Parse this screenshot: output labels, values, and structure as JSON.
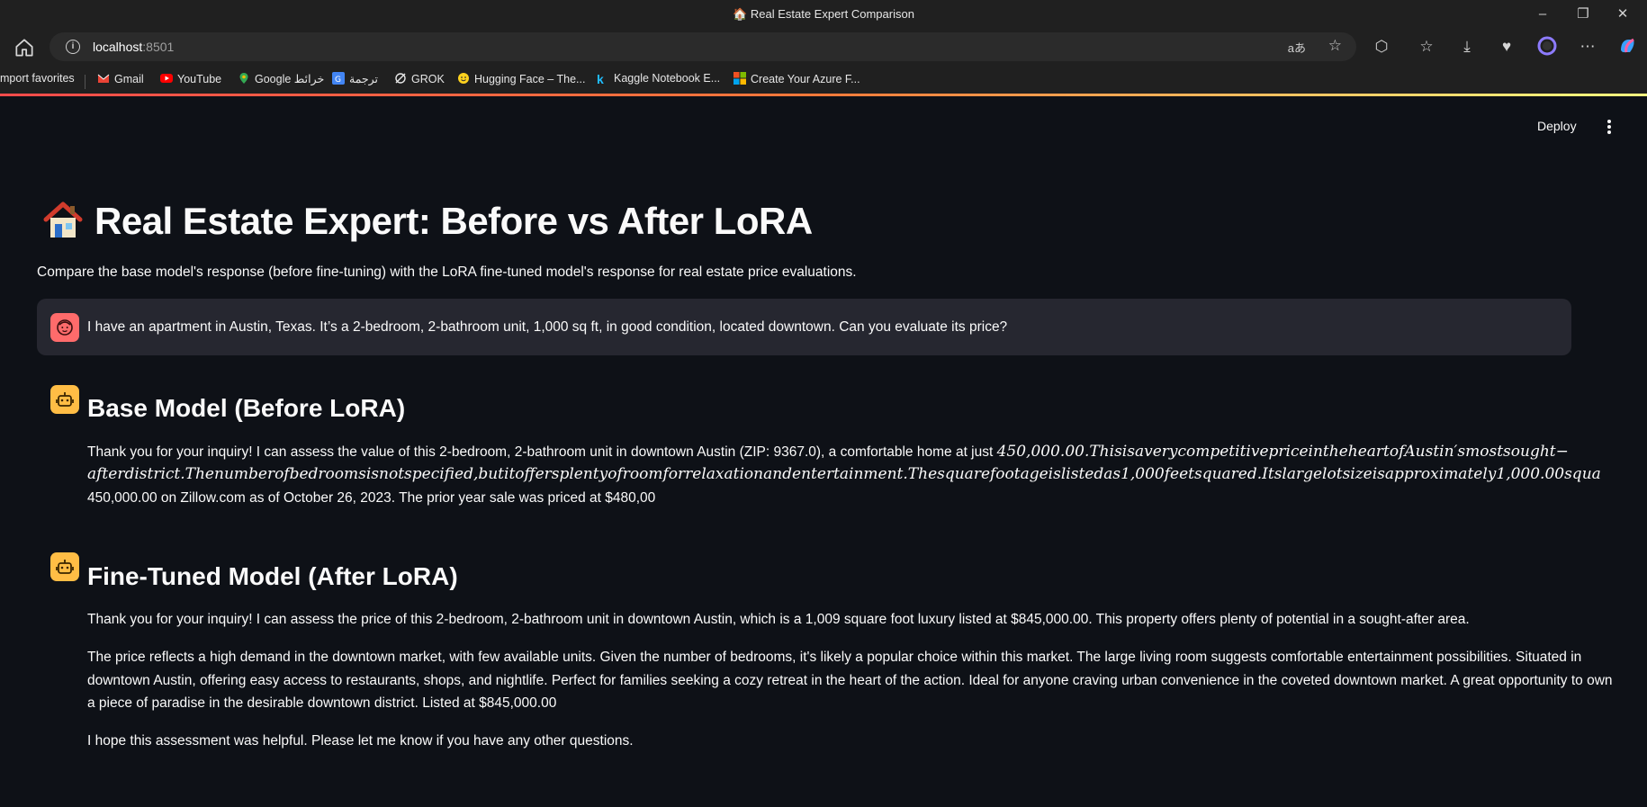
{
  "window": {
    "title": "Real Estate Expert Comparison"
  },
  "browser": {
    "url_host": "localhost",
    "url_port": ":8501",
    "translate_icon": "aあ",
    "bookmarks": [
      {
        "label": "mport favorites",
        "icon": "import-icon"
      },
      {
        "label": "Gmail",
        "icon": "gmail-icon"
      },
      {
        "label": "YouTube",
        "icon": "youtube-icon"
      },
      {
        "label": "Google خرائط",
        "icon": "maps-icon"
      },
      {
        "label": "ترجمة",
        "icon": "translate-icon"
      },
      {
        "label": "GROK",
        "icon": "grok-icon"
      },
      {
        "label": "Hugging Face – The...",
        "icon": "hugging-face-icon"
      },
      {
        "label": "Kaggle Notebook E...",
        "icon": "kaggle-icon"
      },
      {
        "label": "Create Your Azure F...",
        "icon": "microsoft-icon"
      }
    ]
  },
  "app": {
    "deploy_label": "Deploy",
    "title": "Real Estate Expert: Before vs After LoRA",
    "subtitle": "Compare the base model's response (before fine-tuning) with the LoRA fine-tuned model's response for real estate price evaluations.",
    "user_message": "I have an apartment in Austin, Texas. It’s a 2-bedroom, 2-bathroom unit, 1,000 sq ft, in good condition, located downtown. Can you evaluate its price?",
    "base": {
      "heading": "Base Model (Before LoRA)",
      "line1_plain": "Thank you for your inquiry! I can assess the value of this 2-bedroom, 2-bathroom unit in downtown Austin (ZIP: 9367.0), a comfortable home at just ",
      "line1_math": "450,000.00.ThisisaverycompetitivepriceintheheartofAustin′smostsought−",
      "line2_math": "afterdistrict.Thenumberofbedroomsisnotspecified,butitoffersplentyofroomforrelaxationandentertainment.Thesquarefootageislistedas1,000feetsquared.Itslargelotsizeisapproximately1,000.00squa",
      "line3": "450,000.00 on Zillow.com as of October 26, 2023. The prior year sale was priced at $480,00"
    },
    "finetuned": {
      "heading": "Fine-Tuned Model (After LoRA)",
      "p1": "Thank you for your inquiry! I can assess the price of this 2-bedroom, 2-bathroom unit in downtown Austin, which is a 1,009 square foot luxury listed at $845,000.00. This property offers plenty of potential in a sought-after area.",
      "p2_l1": "The price reflects a high demand in the downtown market, with few available units. Given the number of bedrooms, it's likely a popular choice within this market. The large living room suggests comfortable entertainment possibilities. Situated in",
      "p2_l2": "downtown Austin, offering easy access to restaurants, shops, and nightlife. Perfect for families seeking a cozy retreat in the heart of the action. Ideal for anyone craving urban convenience in the coveted downtown market. A great opportunity to own",
      "p2_l3": "a piece of paradise in the desirable downtown district. Listed at $845,000.00",
      "p3": "I hope this assessment was helpful. Please let me know if you have any other questions."
    }
  }
}
